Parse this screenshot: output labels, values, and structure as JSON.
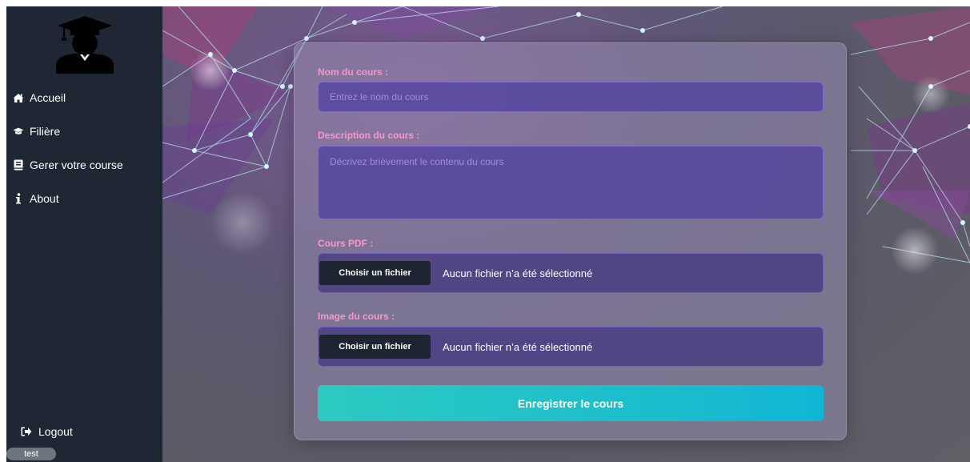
{
  "sidebar": {
    "logo_icon": "graduate-icon",
    "items": [
      {
        "label": "Accueil",
        "icon": "home-icon"
      },
      {
        "label": "Filière",
        "icon": "graduation-cap-icon"
      },
      {
        "label": "Gerer votre course",
        "icon": "book-icon"
      },
      {
        "label": "About",
        "icon": "info-icon"
      }
    ],
    "logout_label": "Logout",
    "logout_icon": "sign-out-icon",
    "user": "test"
  },
  "form": {
    "course_name": {
      "label": "Nom du cours :",
      "placeholder": "Entrez le nom du cours",
      "value": ""
    },
    "description": {
      "label": "Description du cours :",
      "placeholder": "Décrivez brièvement le contenu du cours",
      "value": ""
    },
    "pdf": {
      "label": "Cours PDF :",
      "button": "Choisir un fichier",
      "status": "Aucun fichier n’a été sélectionné"
    },
    "image": {
      "label": "Image du cours :",
      "button": "Choisir un fichier",
      "status": "Aucun fichier n’a été sélectionné"
    },
    "submit_label": "Enregistrer le cours"
  },
  "colors": {
    "sidebar_bg": "#1e2733",
    "label_pink": "#f39ac9",
    "submit_start": "#2ccac0",
    "submit_end": "#12b6d4"
  }
}
